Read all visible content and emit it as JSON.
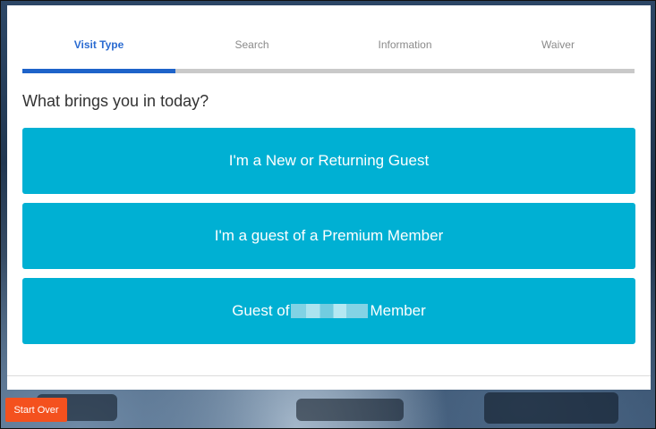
{
  "steps": {
    "items": [
      {
        "label": "Visit Type",
        "active": true
      },
      {
        "label": "Search",
        "active": false
      },
      {
        "label": "Information",
        "active": false
      },
      {
        "label": "Waiver",
        "active": false
      }
    ],
    "progress_fraction": 0.25,
    "active_color": "#2a6bd1",
    "inactive_color": "#8a8a8a"
  },
  "question": "What brings you in today?",
  "choices": [
    {
      "label": "I'm a New or Returning Guest"
    },
    {
      "label": "I'm a guest of a Premium Member"
    },
    {
      "label_prefix": "Guest of",
      "label_suffix": "Member",
      "redacted": true
    }
  ],
  "colors": {
    "choice_button": "#00b0d3",
    "progress_fill": "#1e63c9",
    "start_over": "#f4511e"
  },
  "footer": {
    "start_over_label": "Start Over"
  }
}
